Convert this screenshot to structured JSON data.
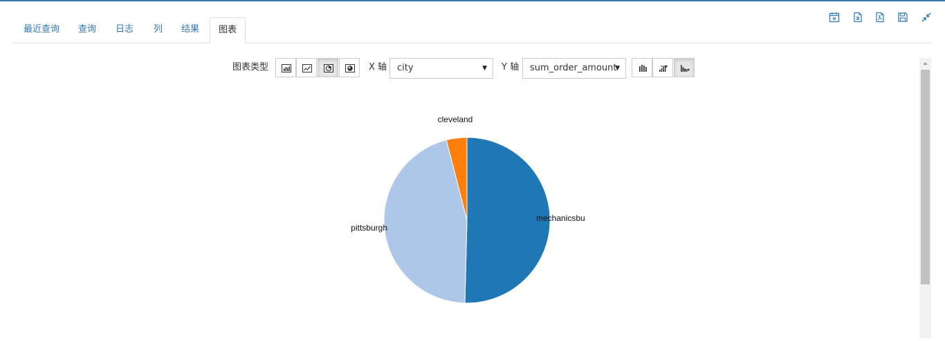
{
  "tabs": [
    {
      "label": "最近查询"
    },
    {
      "label": "查询"
    },
    {
      "label": "日志"
    },
    {
      "label": "列"
    },
    {
      "label": "结果"
    },
    {
      "label": "图表",
      "active": true
    }
  ],
  "header_icons": [
    "calendar-x-icon",
    "excel-file-icon",
    "pdf-file-icon",
    "save-icon",
    "collapse-icon"
  ],
  "toolbar": {
    "chart_type_label": "图表类型",
    "chart_types": [
      "bar-chart-icon",
      "line-chart-icon",
      "pie-chart-icon",
      "map-chart-icon"
    ],
    "active_chart_type": "pie-chart-icon",
    "x_axis_label": "X 轴",
    "x_axis_value": "city",
    "y_axis_label": "Y 轴",
    "y_axis_value": "sum_order_amount",
    "sort_options": [
      "no-sort-icon",
      "sort-ascending-icon",
      "sort-descending-icon"
    ],
    "active_sort": "sort-descending-icon"
  },
  "colors": {
    "accent": "#337ab7",
    "slice_mechanicsburg": "#1f77b4",
    "slice_pittsburgh": "#aec7e8",
    "slice_cleveland": "#ff7f0e"
  },
  "chart_data": {
    "type": "pie",
    "categories": [
      "mechanicsburg",
      "pittsburgh",
      "cleveland"
    ],
    "labels_shown": [
      "mechanicsbu",
      "pittsburgh",
      "cleveland"
    ],
    "values": [
      50.4,
      45.6,
      4.0
    ],
    "unit": "percent of total (estimated)"
  }
}
